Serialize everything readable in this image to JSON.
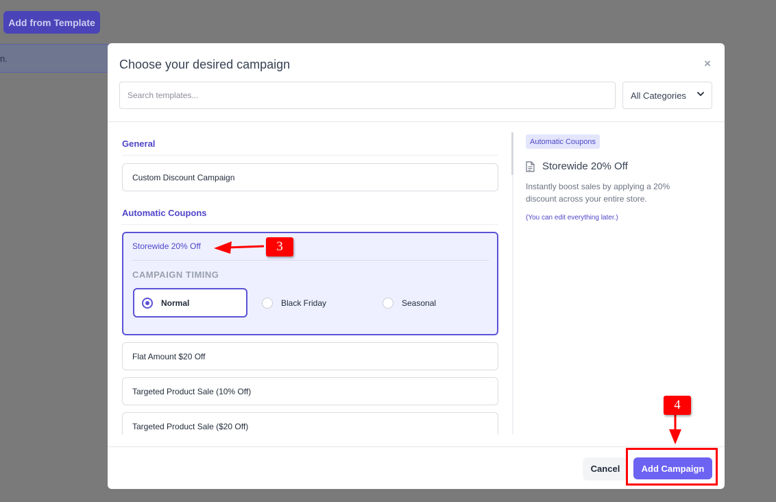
{
  "background": {
    "add_template_label": "Add from Template",
    "strip_text": "n."
  },
  "modal": {
    "title": "Choose your desired campaign",
    "close_label": "×",
    "search_placeholder": "Search templates...",
    "category_value": "All Categories",
    "sections": [
      {
        "title": "General",
        "items": [
          "Custom Discount Campaign"
        ]
      },
      {
        "title": "Automatic Coupons",
        "items": [
          "Storewide 20% Off",
          "Flat Amount $20 Off",
          "Targeted Product Sale (10% Off)",
          "Targeted Product Sale ($20 Off)"
        ]
      }
    ],
    "selected": {
      "name": "Storewide 20% Off",
      "timing_label": "CAMPAIGN TIMING",
      "options": [
        "Normal",
        "Black Friday",
        "Seasonal"
      ],
      "selected_option": "Normal"
    },
    "preview": {
      "badge": "Automatic Coupons",
      "icon": "document-icon",
      "title": "Storewide 20% Off",
      "description": "Instantly boost sales by applying a 20% discount across your entire store.",
      "note": "(You can edit everything later.)"
    },
    "footer": {
      "cancel_label": "Cancel",
      "add_label": "Add Campaign"
    }
  },
  "annotations": {
    "step3": "3",
    "step4": "4",
    "color": "#ff0000"
  },
  "colors": {
    "accent": "#5b52d6",
    "primary_button": "#6c63f2",
    "overlay": "#7a7a7a"
  }
}
